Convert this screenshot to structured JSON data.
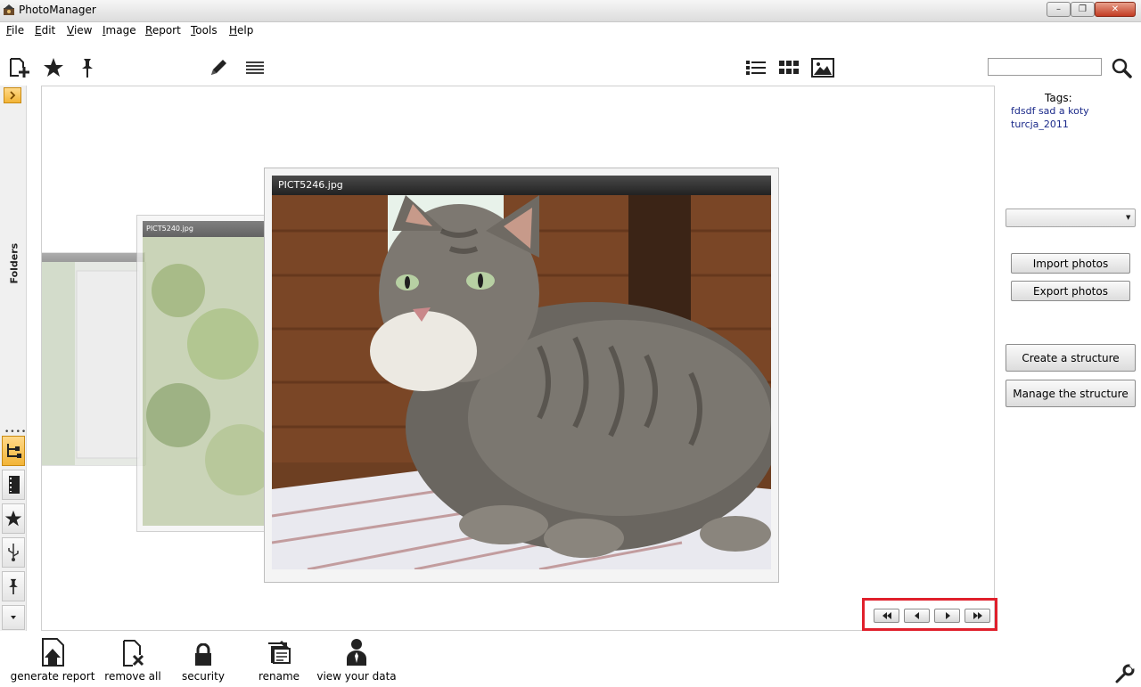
{
  "window": {
    "title": "PhotoManager"
  },
  "menu": [
    "File",
    "Edit",
    "View",
    "Image",
    "Report",
    "Tools",
    "Help"
  ],
  "toolbar": {
    "left_icons": [
      "add-folder-icon",
      "star-icon",
      "pin-icon",
      "pencil-icon",
      "lines-icon"
    ],
    "view_icons": [
      "list-view-icon",
      "grid-view-icon",
      "image-view-icon"
    ],
    "search": {
      "value": "",
      "placeholder": ""
    }
  },
  "sidebar": {
    "folders_label": "Folders",
    "tabs": [
      "hierarchy-icon",
      "film-icon",
      "star-icon",
      "usb-icon",
      "pin-icon",
      "dropdown-icon"
    ],
    "active_tab": "hierarchy-icon"
  },
  "viewer": {
    "front_title": "PICT5246.jpg",
    "middle_title": "PICT5240.jpg"
  },
  "navigation": [
    "first",
    "previous",
    "next",
    "last"
  ],
  "right_panel": {
    "tags_title": "Tags:",
    "tags": [
      "fdsdf sad a koty",
      "turcja_2011"
    ],
    "album_select_value": "",
    "buttons": {
      "import": "Import photos",
      "export": "Export photos",
      "create": "Create a structure",
      "manage": "Manage the structure"
    }
  },
  "actions": {
    "generate_report": "generate report",
    "remove_all": "remove all",
    "security": "security",
    "rename": "rename",
    "view_data": "view your data"
  },
  "colors": {
    "highlight": "#e0202c",
    "accent": "#f2b437",
    "tag_link": "#1b2a8a"
  }
}
